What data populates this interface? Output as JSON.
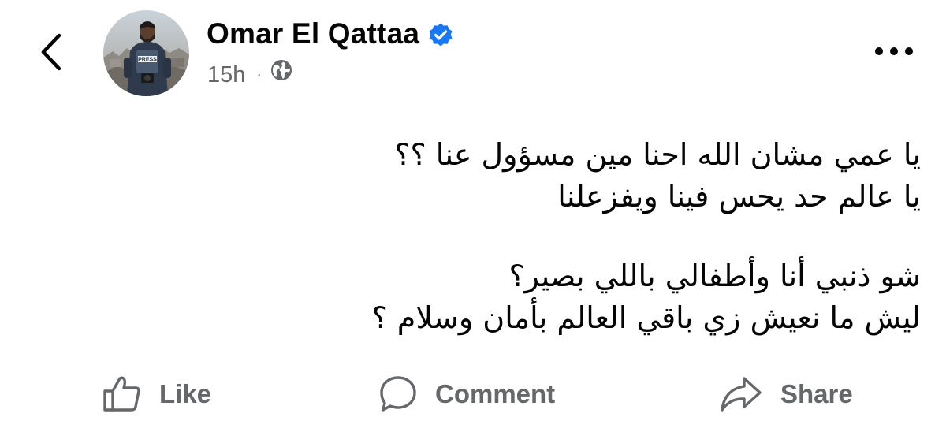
{
  "post": {
    "author": "Omar El Qattaa",
    "time": "15h",
    "separator": "·",
    "audience_icon": "globe-icon",
    "verified_icon": "verified-badge-icon",
    "avatar_badge_text": "PRESS",
    "lines": [
      "يا عمي مشان الله احنا مين مسؤول عنا ؟؟",
      "يا عالم حد يحس فينا ويفزعلنا",
      "شو ذنبي أنا وأطفالي باللي بصير؟",
      "ليش ما نعيش زي باقي العالم بأمان وسلام ؟"
    ]
  },
  "actions": {
    "like": "Like",
    "comment": "Comment",
    "share": "Share"
  },
  "colors": {
    "text": "#050505",
    "secondary": "#65676b",
    "verified": "#1877f2"
  }
}
